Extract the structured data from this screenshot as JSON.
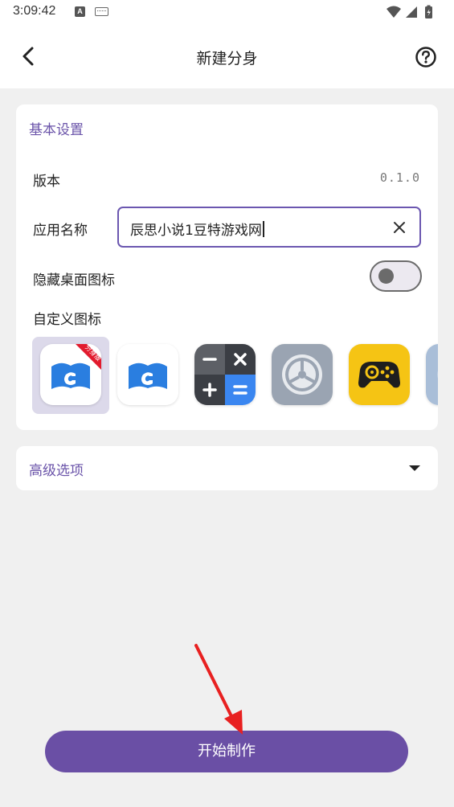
{
  "status_bar": {
    "time": "3:09:42",
    "a_badge": "A"
  },
  "header": {
    "title": "新建分身",
    "back_icon": "back-arrow-icon",
    "help_icon": "help-circle-icon"
  },
  "basic_settings": {
    "title": "基本设置",
    "version_label": "版本",
    "version_value": "0.1.0",
    "app_name_label": "应用名称",
    "app_name_value": "辰思小说1豆特游戏网",
    "hide_icon_label": "隐藏桌面图标",
    "hide_icon_enabled": false,
    "custom_icon_label": "自定义图标",
    "icon_badge_text": "分身版",
    "icons": [
      "book-app-icon-clone",
      "book-app-icon",
      "calculator-icon",
      "settings-gear-icon",
      "gamepad-icon",
      "partial-icon"
    ],
    "selected_icon_index": 0
  },
  "advanced": {
    "title": "高级选项"
  },
  "actions": {
    "start_label": "开始制作"
  },
  "colors": {
    "accent": "#6a4fa5",
    "section_title": "#6a53a9",
    "annotation_arrow": "#e82020"
  }
}
